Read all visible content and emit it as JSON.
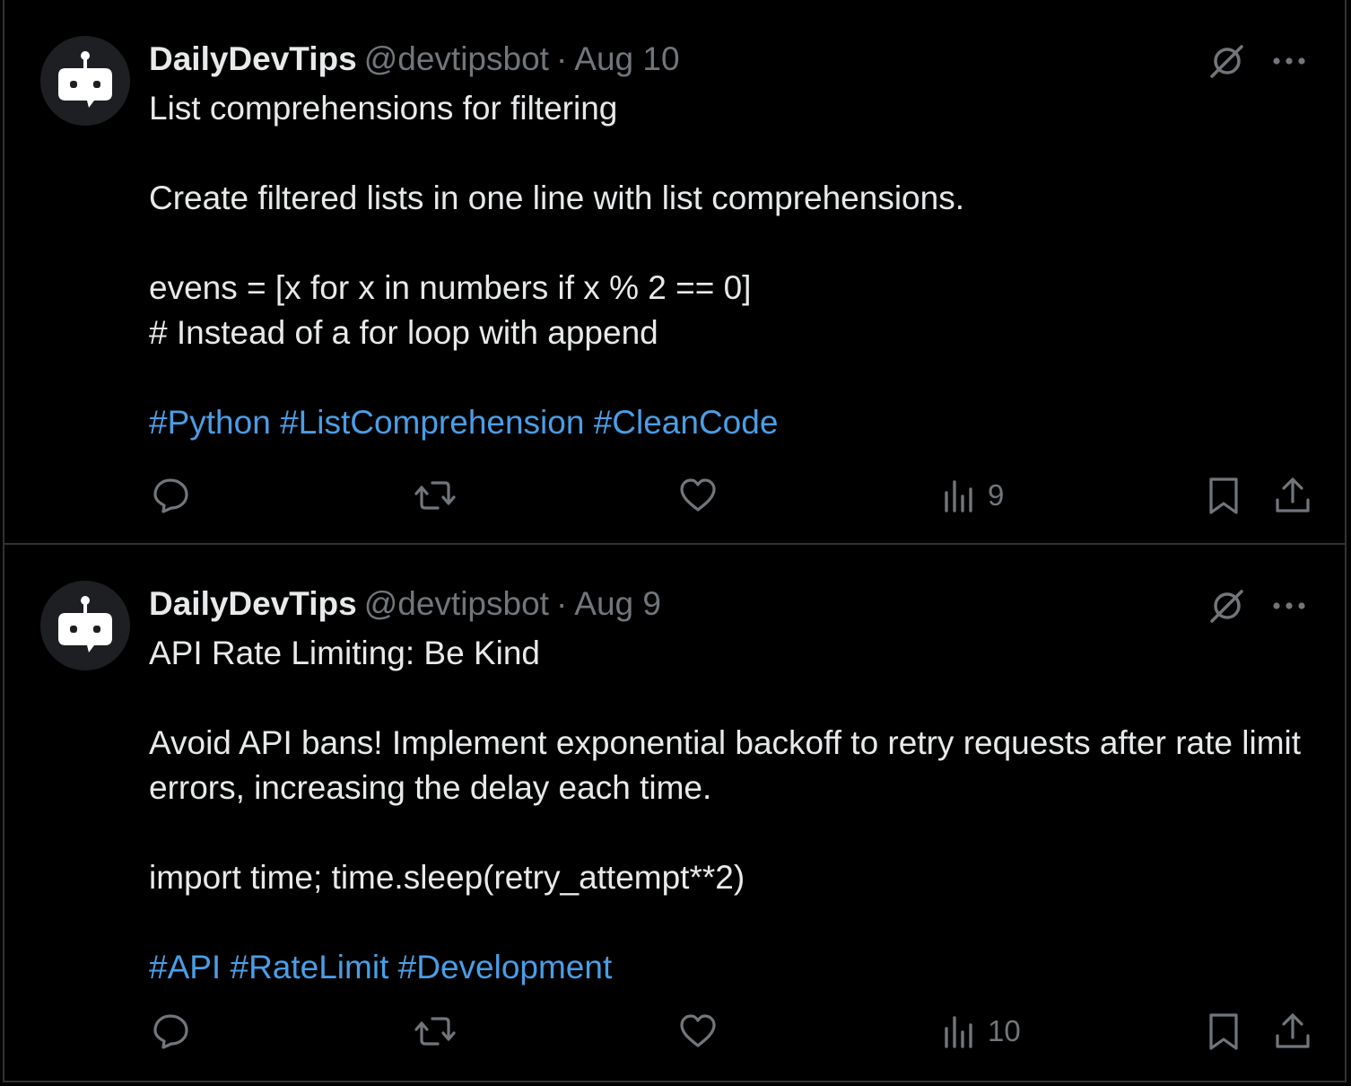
{
  "posts": [
    {
      "author": {
        "display_name": "DailyDevTips",
        "handle": "@devtipsbot",
        "avatar_icon": "robot-icon"
      },
      "separator": "·",
      "date": "Aug 10",
      "lines": [
        "List comprehensions for filtering",
        "",
        "Create filtered lists in one line with list comprehensions.",
        "",
        "evens = [x for x in numbers if x % 2 == 0]",
        "# Instead of a for loop with append",
        ""
      ],
      "hashtags": [
        "#Python",
        "#ListComprehension",
        "#CleanCode"
      ],
      "views": "9"
    },
    {
      "author": {
        "display_name": "DailyDevTips",
        "handle": "@devtipsbot",
        "avatar_icon": "robot-icon"
      },
      "separator": "·",
      "date": "Aug 9",
      "lines": [
        "API Rate Limiting: Be Kind",
        "",
        "Avoid API bans! Implement exponential backoff to retry requests after rate limit errors, increasing the delay each time.",
        "",
        "import time; time.sleep(retry_attempt**2)",
        ""
      ],
      "hashtags": [
        "#API",
        "#RateLimit",
        "#Development"
      ],
      "views": "10"
    }
  ],
  "colors": {
    "background": "#000000",
    "text": "#e7e9ea",
    "secondary_text": "#71767b",
    "hashtag": "#4a9ee6",
    "divider": "#2f3336"
  },
  "icons": {
    "grok": "grok-icon",
    "more": "more-icon",
    "reply": "reply-icon",
    "repost": "repost-icon",
    "like": "like-icon",
    "views": "views-icon",
    "bookmark": "bookmark-icon",
    "share": "share-icon"
  }
}
